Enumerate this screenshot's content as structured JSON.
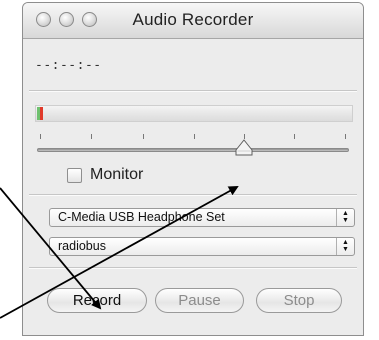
{
  "window": {
    "title": "Audio Recorder"
  },
  "time_display": "--:--:--",
  "level_meter": {
    "level_fraction": 0.02,
    "peak_color": "#e03a2a",
    "signal_color": "#6fc16f"
  },
  "gain_slider": {
    "value_fraction": 0.68,
    "tick_count": 7
  },
  "monitor": {
    "label": "Monitor",
    "checked": false
  },
  "input_device": {
    "selected": "C-Media USB Headphone Set"
  },
  "output_target": {
    "selected": "radiobus"
  },
  "buttons": {
    "record": "Record",
    "pause": "Pause",
    "stop": "Stop"
  },
  "annotation": {
    "arrow_color": "#000000"
  }
}
